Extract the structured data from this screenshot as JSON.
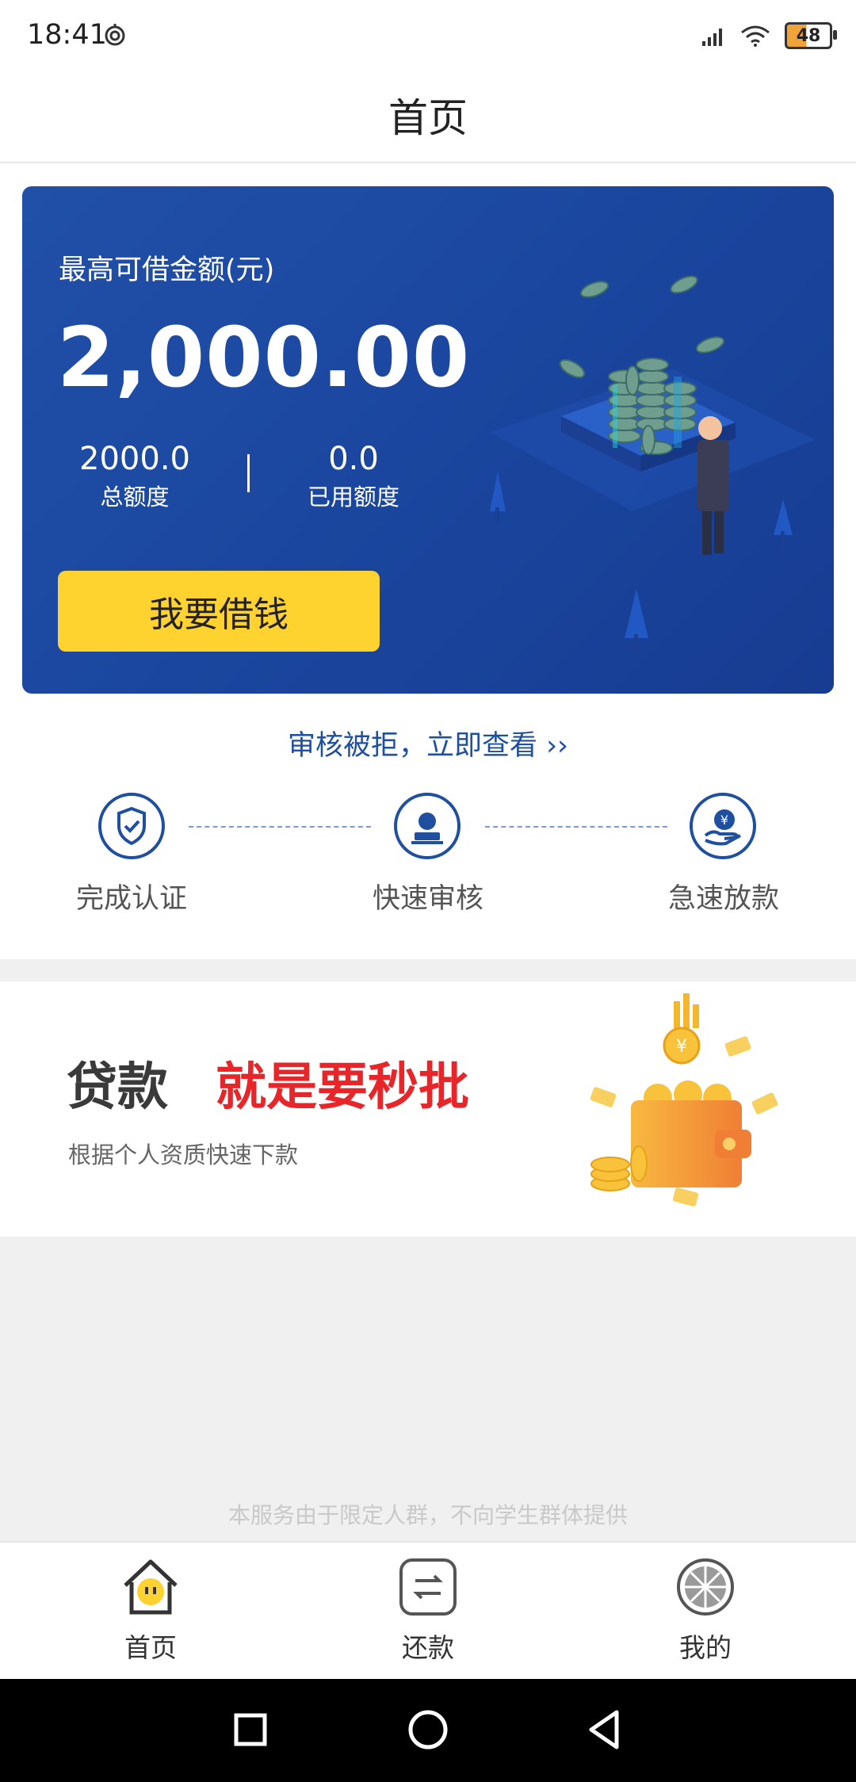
{
  "status_bar": {
    "time": "18:41",
    "battery": "48"
  },
  "header": {
    "title": "首页"
  },
  "hero": {
    "label": "最高可借金额(元)",
    "amount": "2,000.00",
    "total_value": "2000.0",
    "total_label": "总额度",
    "used_value": "0.0",
    "used_label": "已用额度",
    "borrow_button": "我要借钱"
  },
  "reject_link": "审核被拒，立即查看 ››",
  "steps": [
    {
      "label": "完成认证",
      "icon": "shield-check-icon"
    },
    {
      "label": "快速审核",
      "icon": "user-stamp-icon"
    },
    {
      "label": "急速放款",
      "icon": "hand-yuan-icon"
    }
  ],
  "promo": {
    "title_left": "贷款",
    "title_right": "就是要秒批",
    "subtitle": "根据个人资质快速下款"
  },
  "disclaimer": "本服务由于限定人群，不向学生群体提供",
  "tabs": [
    {
      "label": "首页",
      "icon": "home-icon",
      "active": true
    },
    {
      "label": "还款",
      "icon": "repay-icon",
      "active": false
    },
    {
      "label": "我的",
      "icon": "profile-icon",
      "active": false
    }
  ],
  "colors": {
    "primary": "#1e4fa0",
    "accent_yellow": "#fed22f",
    "promo_red": "#e8262a"
  }
}
